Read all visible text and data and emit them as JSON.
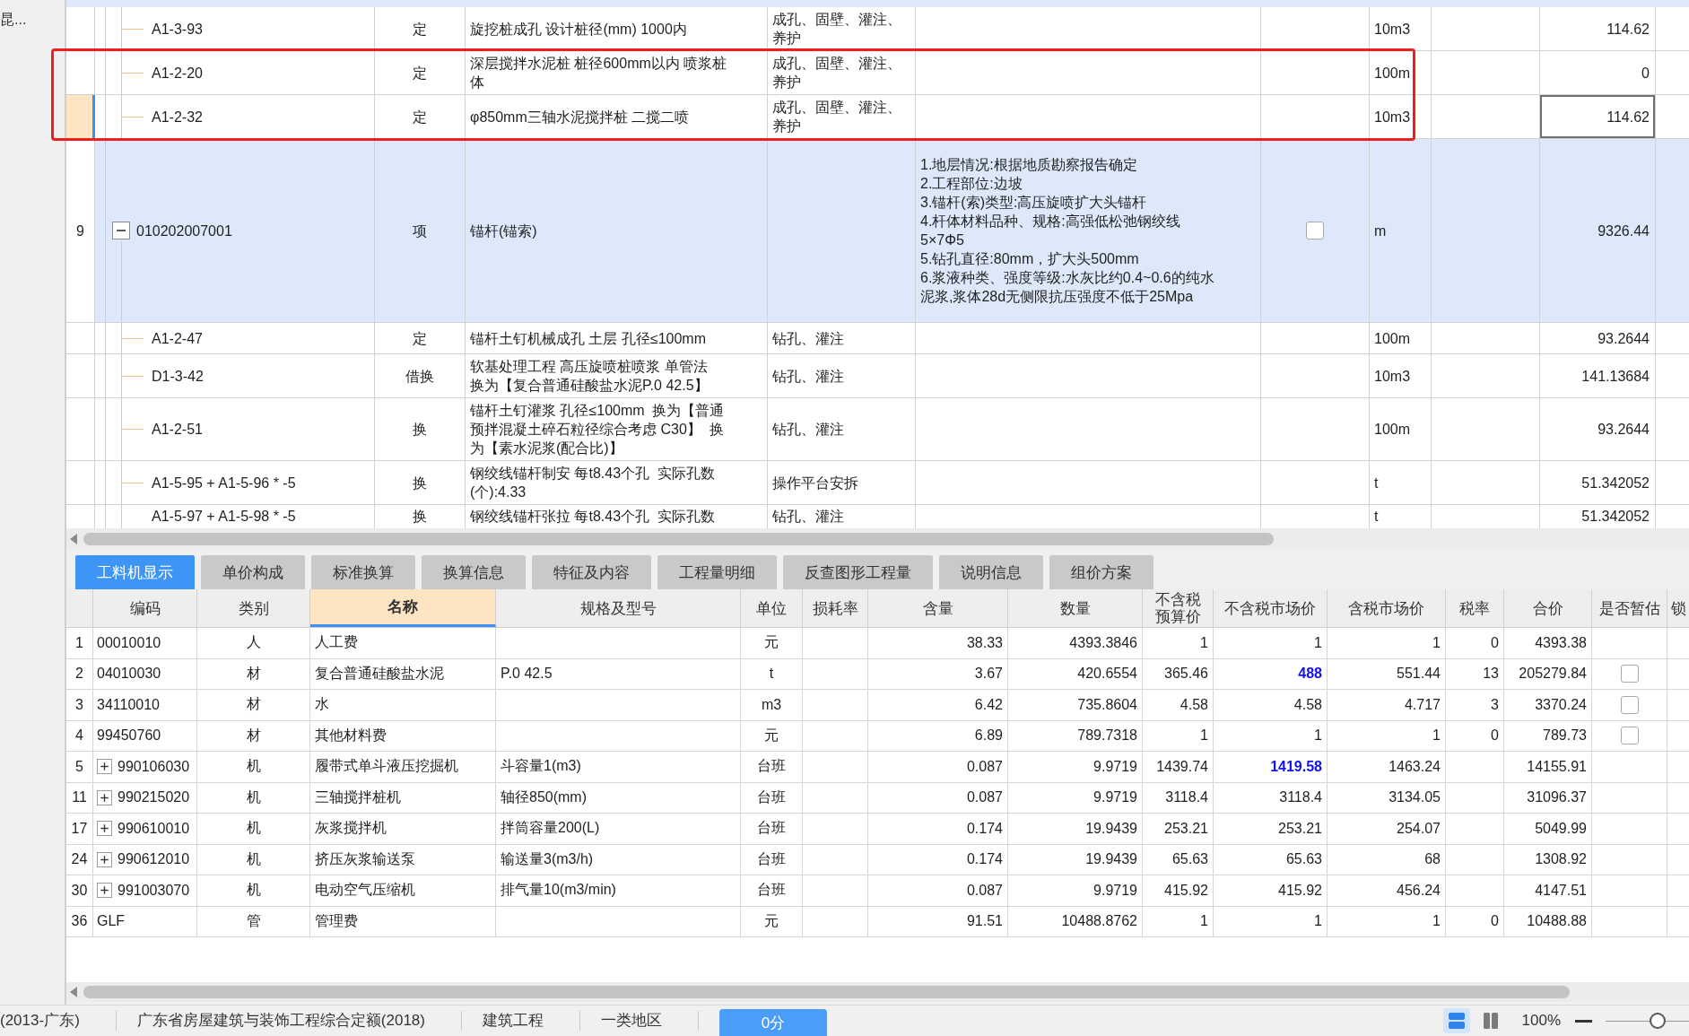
{
  "sidebar": {
    "label": "昆..."
  },
  "bill_table": {
    "rows": [
      {
        "kind": "quota",
        "selected": false,
        "annotated": false,
        "cut_off": false,
        "column_2": "A1-3-93",
        "column_3": "定",
        "column_4": [
          "旋挖桩成孔 设计桩径(mm) 1000内"
        ],
        "column_5": [
          "成孔、固壁、灌注、",
          "养护"
        ],
        "column_8": "10m3",
        "column_10": "114.62"
      },
      {
        "kind": "quota",
        "selected": false,
        "annotated": true,
        "cut_off": false,
        "column_2": "A1-2-20",
        "column_3": "定",
        "column_4": [
          "深层搅拌水泥桩 桩径600mm以内 喷浆桩",
          "体"
        ],
        "column_5": [
          "成孔、固壁、灌注、",
          "养护"
        ],
        "column_8": "100m",
        "column_10": "0"
      },
      {
        "kind": "quota",
        "selected": true,
        "annotated": true,
        "cut_off": false,
        "column_2": "A1-2-32",
        "column_3": "定",
        "column_4": [
          "φ850mm三轴水泥搅拌桩 二搅二喷"
        ],
        "column_5": [
          "成孔、固壁、灌注、",
          "养护"
        ],
        "column_8": "10m3",
        "column_10": "114.62"
      },
      {
        "kind": "item",
        "selected": false,
        "annotated": false,
        "cut_off": false,
        "column_1": "9",
        "column_2": "010202007001",
        "toggle": {
          "expanded": true
        },
        "column_3": "项",
        "column_4": [
          "锚杆(锚索)"
        ],
        "column_6": [
          "1.地层情况:根据地质勘察报告确定",
          "2.工程部位:边坡",
          "3.锚杆(索)类型:高压旋喷扩大头锚杆",
          "4.杆体材料品种、规格:高强低松弛钢绞线",
          "5×7Φ5",
          "5.钻孔直径:80mm，扩大头500mm",
          "6.浆液种类、强度等级:水灰比约0.4~0.6的纯水",
          "泥浆,浆体28d无侧限抗压强度不低于25Mpa"
        ],
        "column_7": {
          "checked": false
        },
        "column_8": "m",
        "column_10": "9326.44"
      },
      {
        "kind": "quota",
        "selected": false,
        "annotated": false,
        "cut_off": false,
        "column_2": "A1-2-47",
        "column_3": "定",
        "column_4": [
          "锚杆土钉机械成孔 土层 孔径≤100mm"
        ],
        "column_5": [
          "钻孔、灌注"
        ],
        "column_8": "100m",
        "column_10": "93.2644"
      },
      {
        "kind": "quota",
        "selected": false,
        "annotated": false,
        "cut_off": false,
        "column_2": "D1-3-42",
        "column_3": "借换",
        "column_4": [
          "软基处理工程 高压旋喷桩喷浆 单管法",
          "换为【复合普通硅酸盐水泥P.0 42.5】"
        ],
        "column_5": [
          "钻孔、灌注"
        ],
        "column_8": "10m3",
        "column_10": "141.13684"
      },
      {
        "kind": "quota",
        "selected": false,
        "annotated": false,
        "cut_off": false,
        "column_2": "A1-2-51",
        "column_3": "换",
        "column_4": [
          "锚杆土钉灌浆 孔径≤100mm  换为【普通",
          "预拌混凝土碎石粒径综合考虑 C30】  换",
          "为【素水泥浆(配合比)】"
        ],
        "column_5": [
          "钻孔、灌注"
        ],
        "column_8": "100m",
        "column_10": "93.2644"
      },
      {
        "kind": "quota",
        "selected": false,
        "annotated": false,
        "cut_off": false,
        "column_2": "A1-5-95 + A1-5-96 * -5",
        "column_3": "换",
        "column_4": [
          "钢绞线锚杆制安 每t8.43个孔  实际孔数",
          "(个):4.33"
        ],
        "column_5": [
          "操作平台安拆"
        ],
        "column_8": "t",
        "column_10": "51.342052"
      },
      {
        "kind": "quota",
        "selected": false,
        "annotated": false,
        "cut_off": true,
        "column_2": "A1-5-97 + A1-5-98 * -5",
        "column_3": "换",
        "column_4": [
          "钢绞线锚杆张拉 每t8.43个孔  实际孔数"
        ],
        "column_5": [
          "钻孔、灌注"
        ],
        "column_8": "t",
        "column_10": "51.342052"
      }
    ]
  },
  "detail_tabs": [
    {
      "label": "工料机显示",
      "selected": true
    },
    {
      "label": "单价构成",
      "selected": false
    },
    {
      "label": "标准换算",
      "selected": false
    },
    {
      "label": "换算信息",
      "selected": false
    },
    {
      "label": "特征及内容",
      "selected": false
    },
    {
      "label": "工程量明细",
      "selected": false
    },
    {
      "label": "反查图形工程量",
      "selected": false
    },
    {
      "label": "说明信息",
      "selected": false
    },
    {
      "label": "组价方案",
      "selected": false
    }
  ],
  "resource_table": {
    "columns": [
      {
        "label": "编码",
        "selected": false
      },
      {
        "label": "类别",
        "selected": false
      },
      {
        "label": "名称",
        "selected": true
      },
      {
        "label": "规格及型号",
        "selected": false
      },
      {
        "label": "单位",
        "selected": false
      },
      {
        "label": "损耗率",
        "selected": false
      },
      {
        "label": "含量",
        "selected": false
      },
      {
        "label": "数量",
        "selected": false
      },
      {
        "lines": [
          "不含税",
          "预算价"
        ],
        "selected": false
      },
      {
        "label": "不含税市场价",
        "selected": false
      },
      {
        "label": "含税市场价",
        "selected": false
      },
      {
        "label": "税率",
        "selected": false
      },
      {
        "label": "合价",
        "selected": false
      },
      {
        "label": "是否暂估",
        "selected": false
      },
      {
        "label": "锁",
        "selected": false
      }
    ],
    "rows": [
      {
        "number": "1",
        "code": "00010010",
        "category": "人",
        "name": "人工费",
        "unit": "元",
        "content": "38.33",
        "quantity": "4393.3846",
        "budget_price": "1",
        "market_price": "1",
        "price_modified": false,
        "market_price_with_tax": "1",
        "tax_rate": "0",
        "total": "4393.38"
      },
      {
        "number": "2",
        "code": "04010030",
        "category": "材",
        "name": "复合普通硅酸盐水泥",
        "spec": "P.0 42.5",
        "unit": "t",
        "content": "3.67",
        "quantity": "420.6554",
        "budget_price": "365.46",
        "market_price": "488",
        "price_modified": true,
        "market_price_with_tax": "551.44",
        "tax_rate": "13",
        "total": "205279.84",
        "provisional": {
          "checked": false
        }
      },
      {
        "number": "3",
        "code": "34110010",
        "category": "材",
        "name": "水",
        "unit": "m3",
        "content": "6.42",
        "quantity": "735.8604",
        "budget_price": "4.58",
        "market_price": "4.58",
        "price_modified": false,
        "market_price_with_tax": "4.717",
        "tax_rate": "3",
        "total": "3370.24",
        "provisional": {
          "checked": false
        }
      },
      {
        "number": "4",
        "code": "99450760",
        "category": "材",
        "name": "其他材料费",
        "unit": "元",
        "content": "6.89",
        "quantity": "789.7318",
        "budget_price": "1",
        "market_price": "1",
        "price_modified": false,
        "market_price_with_tax": "1",
        "tax_rate": "0",
        "total": "789.73",
        "provisional": {
          "checked": false
        }
      },
      {
        "number": "5",
        "toggle": {
          "expanded": false
        },
        "code": "990106030",
        "category": "机",
        "name": "履带式单斗液压挖掘机",
        "spec": "斗容量1(m3)",
        "unit": "台班",
        "content": "0.087",
        "quantity": "9.9719",
        "budget_price": "1439.74",
        "market_price": "1419.58",
        "price_modified": true,
        "market_price_with_tax": "1463.24",
        "total": "14155.91"
      },
      {
        "number": "11",
        "toggle": {
          "expanded": false
        },
        "code": "990215020",
        "category": "机",
        "name": "三轴搅拌桩机",
        "spec": "轴径850(mm)",
        "unit": "台班",
        "content": "0.087",
        "quantity": "9.9719",
        "budget_price": "3118.4",
        "market_price": "3118.4",
        "price_modified": false,
        "market_price_with_tax": "3134.05",
        "total": "31096.37"
      },
      {
        "number": "17",
        "toggle": {
          "expanded": false
        },
        "code": "990610010",
        "category": "机",
        "name": "灰浆搅拌机",
        "spec": "拌筒容量200(L)",
        "unit": "台班",
        "content": "0.174",
        "quantity": "19.9439",
        "budget_price": "253.21",
        "market_price": "253.21",
        "price_modified": false,
        "market_price_with_tax": "254.07",
        "total": "5049.99"
      },
      {
        "number": "24",
        "toggle": {
          "expanded": false
        },
        "code": "990612010",
        "category": "机",
        "name": "挤压灰浆输送泵",
        "spec": "输送量3(m3/h)",
        "unit": "台班",
        "content": "0.174",
        "quantity": "19.9439",
        "budget_price": "65.63",
        "market_price": "65.63",
        "price_modified": false,
        "market_price_with_tax": "68",
        "total": "1308.92"
      },
      {
        "number": "30",
        "toggle": {
          "expanded": false
        },
        "code": "991003070",
        "category": "机",
        "name": "电动空气压缩机",
        "spec": "排气量10(m3/min)",
        "unit": "台班",
        "content": "0.087",
        "quantity": "9.9719",
        "budget_price": "415.92",
        "market_price": "415.92",
        "price_modified": false,
        "market_price_with_tax": "456.24",
        "total": "4147.51"
      },
      {
        "number": "36",
        "code": "GLF",
        "category": "管",
        "name": "管理费",
        "unit": "元",
        "content": "91.51",
        "quantity": "10488.8762",
        "budget_price": "1",
        "market_price": "1",
        "price_modified": false,
        "market_price_with_tax": "1",
        "tax_rate": "0",
        "total": "10488.88"
      }
    ]
  },
  "status_bar": {
    "items": [
      {
        "kind": "text",
        "label": "(2013-广东)"
      },
      {
        "kind": "text",
        "label": "广东省房屋建筑与装饰工程综合定额(2018)"
      },
      {
        "kind": "text",
        "label": "建筑工程"
      },
      {
        "kind": "text",
        "label": "一类地区"
      },
      {
        "kind": "button",
        "label": "0分"
      }
    ],
    "layout_buttons": [
      {
        "kind": "rows",
        "selected": true
      },
      {
        "kind": "columns",
        "selected": false
      }
    ],
    "zoom": {
      "reading": "100%",
      "level": 0.62
    }
  }
}
